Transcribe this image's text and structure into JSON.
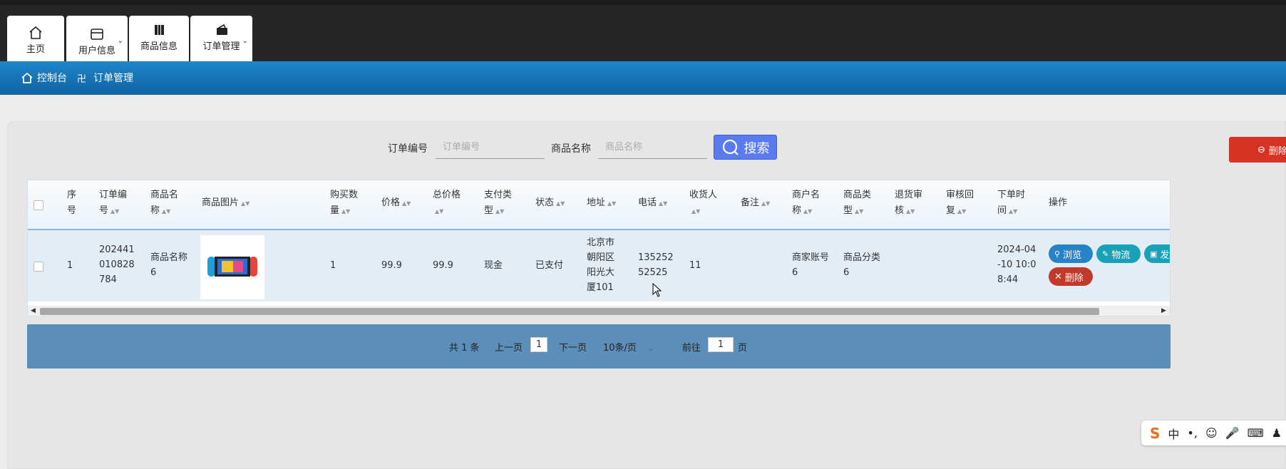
{
  "nav": {
    "tabs": [
      {
        "label": "主页",
        "icon": "home-icon"
      },
      {
        "label": "用户信息",
        "icon": "wallet-icon"
      },
      {
        "label": "商品信息",
        "icon": "book-icon"
      },
      {
        "label": "订单管理",
        "icon": "purse-icon"
      }
    ]
  },
  "breadcrumb": {
    "home": "控制台",
    "current": "订单管理"
  },
  "search": {
    "order_no_label": "订单编号",
    "order_no_placeholder": "订单编号",
    "product_name_label": "商品名称",
    "product_name_placeholder": "商品名称",
    "button_label": "搜索"
  },
  "toolbar": {
    "delete_label": "删除"
  },
  "table": {
    "columns": [
      {
        "key": "seq",
        "label": "序号"
      },
      {
        "key": "order_no",
        "label": "订单编号"
      },
      {
        "key": "product_name",
        "label": "商品名称"
      },
      {
        "key": "image",
        "label": "商品图片"
      },
      {
        "key": "quantity",
        "label": "购买数量"
      },
      {
        "key": "price",
        "label": "价格"
      },
      {
        "key": "total",
        "label": "总价格"
      },
      {
        "key": "pay_type",
        "label": "支付类型"
      },
      {
        "key": "status",
        "label": "状态"
      },
      {
        "key": "address",
        "label": "地址"
      },
      {
        "key": "phone",
        "label": "电话"
      },
      {
        "key": "receiver",
        "label": "收货人"
      },
      {
        "key": "remark",
        "label": "备注"
      },
      {
        "key": "merchant",
        "label": "商户名称"
      },
      {
        "key": "category",
        "label": "商品类型"
      },
      {
        "key": "refund_review",
        "label": "退货审核"
      },
      {
        "key": "review_reply",
        "label": "审核回复"
      },
      {
        "key": "order_time",
        "label": "下单时间"
      },
      {
        "key": "actions",
        "label": "操作"
      }
    ],
    "rows": [
      {
        "seq": "1",
        "order_no": "202441010828784",
        "product_name": "商品名称6",
        "quantity": "1",
        "price": "99.9",
        "total": "99.9",
        "pay_type": "现金",
        "status": "已支付",
        "address": "北京市朝阳区阳光大厦101",
        "phone": "13525252525",
        "receiver": "11",
        "remark": "",
        "merchant": "商家账号6",
        "category": "商品分类6",
        "refund_review": "",
        "review_reply": "",
        "order_time": "2024-04-10 10:08:44"
      }
    ],
    "actions": {
      "view": "浏览",
      "logistics": "物流",
      "ship": "发",
      "delete": "删除"
    }
  },
  "pagination": {
    "total_text": "共 1 条",
    "prev": "上一页",
    "current_page": "1",
    "next": "下一页",
    "page_size": "10条/页",
    "goto_label": "前往",
    "goto_value": "1",
    "page_suffix": "页"
  },
  "ime": {
    "lang": "中"
  },
  "colors": {
    "topbar": "#262626",
    "breadcrumb_bar": "#1877bd",
    "search_button": "#5a7bf0",
    "delete_button": "#d63325",
    "action_teal": "#17a2b8",
    "action_blue": "#2684c6",
    "pager_bg": "#5b8fba"
  }
}
